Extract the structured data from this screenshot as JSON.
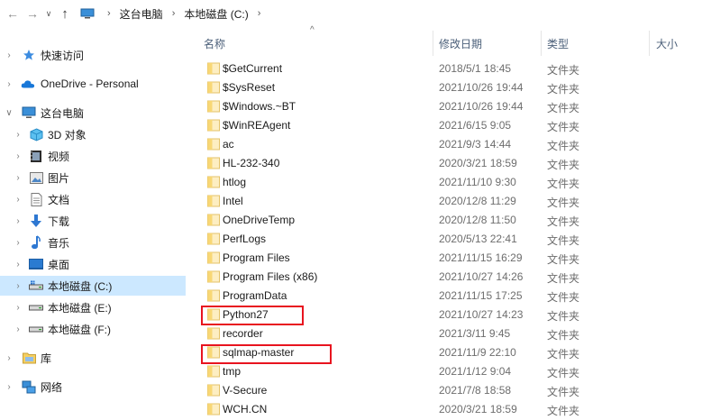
{
  "breadcrumb": {
    "items": [
      "这台电脑",
      "本地磁盘 (C:)"
    ],
    "separator": "›"
  },
  "toolbar": {
    "back_glyph": "←",
    "forward_glyph": "→",
    "dropdown_glyph": "∨",
    "up_glyph": "↑"
  },
  "sidebar": {
    "items": [
      {
        "label": "快速访问",
        "icon": "star-icon"
      },
      {
        "label": "OneDrive - Personal",
        "icon": "cloud-icon"
      },
      {
        "label": "这台电脑",
        "icon": "pc-icon"
      },
      {
        "label": "3D 对象",
        "icon": "cube-icon"
      },
      {
        "label": "视频",
        "icon": "video-icon"
      },
      {
        "label": "图片",
        "icon": "picture-icon"
      },
      {
        "label": "文档",
        "icon": "document-icon"
      },
      {
        "label": "下载",
        "icon": "download-icon"
      },
      {
        "label": "音乐",
        "icon": "music-icon"
      },
      {
        "label": "桌面",
        "icon": "desktop-icon"
      },
      {
        "label": "本地磁盘 (C:)",
        "icon": "drive-c-icon"
      },
      {
        "label": "本地磁盘 (E:)",
        "icon": "drive-icon"
      },
      {
        "label": "本地磁盘 (F:)",
        "icon": "drive-icon"
      },
      {
        "label": "库",
        "icon": "library-icon"
      },
      {
        "label": "网络",
        "icon": "network-icon"
      }
    ]
  },
  "columns": {
    "name": "名称",
    "modified": "修改日期",
    "type": "类型",
    "size": "大小",
    "sort_glyph": "^"
  },
  "files": [
    {
      "name": "$GetCurrent",
      "date": "2018/5/1 18:45",
      "type": "文件夹"
    },
    {
      "name": "$SysReset",
      "date": "2021/10/26 19:44",
      "type": "文件夹"
    },
    {
      "name": "$Windows.~BT",
      "date": "2021/10/26 19:44",
      "type": "文件夹"
    },
    {
      "name": "$WinREAgent",
      "date": "2021/6/15 9:05",
      "type": "文件夹"
    },
    {
      "name": "ac",
      "date": "2021/9/3 14:44",
      "type": "文件夹"
    },
    {
      "name": "HL-232-340",
      "date": "2020/3/21 18:59",
      "type": "文件夹"
    },
    {
      "name": "htlog",
      "date": "2021/11/10 9:30",
      "type": "文件夹"
    },
    {
      "name": "Intel",
      "date": "2020/12/8 11:29",
      "type": "文件夹"
    },
    {
      "name": "OneDriveTemp",
      "date": "2020/12/8 11:50",
      "type": "文件夹"
    },
    {
      "name": "PerfLogs",
      "date": "2020/5/13 22:41",
      "type": "文件夹"
    },
    {
      "name": "Program Files",
      "date": "2021/11/15 16:29",
      "type": "文件夹"
    },
    {
      "name": "Program Files (x86)",
      "date": "2021/10/27 14:26",
      "type": "文件夹"
    },
    {
      "name": "ProgramData",
      "date": "2021/11/15 17:25",
      "type": "文件夹"
    },
    {
      "name": "Python27",
      "date": "2021/10/27 14:23",
      "type": "文件夹"
    },
    {
      "name": "recorder",
      "date": "2021/3/11 9:45",
      "type": "文件夹"
    },
    {
      "name": "sqlmap-master",
      "date": "2021/11/9 22:10",
      "type": "文件夹"
    },
    {
      "name": "tmp",
      "date": "2021/1/12 9:04",
      "type": "文件夹"
    },
    {
      "name": "V-Secure",
      "date": "2021/7/8 18:58",
      "type": "文件夹"
    },
    {
      "name": "WCH.CN",
      "date": "2020/3/21 18:59",
      "type": "文件夹"
    }
  ],
  "colors": {
    "selection": "#cce8ff",
    "highlight_box": "#e8141f",
    "folder": "#f8d775",
    "header_text": "#4c607a"
  }
}
